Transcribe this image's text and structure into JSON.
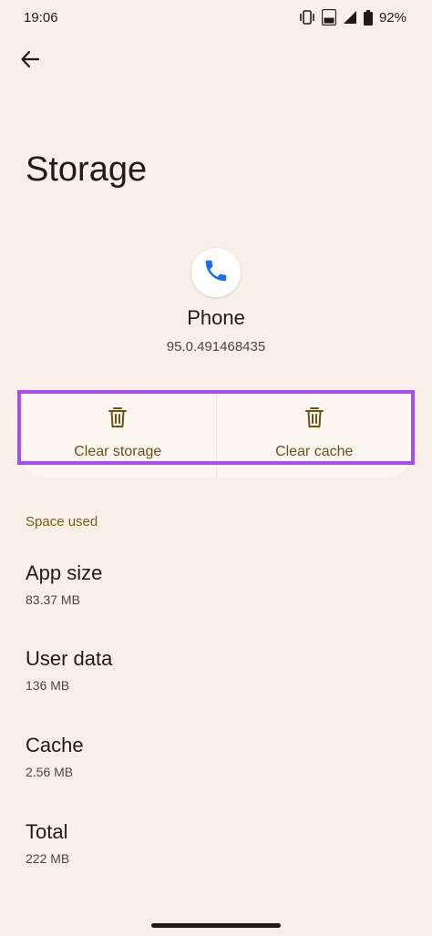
{
  "status_bar": {
    "time": "19:06",
    "battery": "92%",
    "icons": [
      "vibrate-icon",
      "volte-icon",
      "signal-icon",
      "battery-icon"
    ],
    "volte_text": "Vo LTE"
  },
  "header": {
    "back_icon": "arrow-back-icon",
    "title": "Storage"
  },
  "app": {
    "icon": "phone-icon",
    "name": "Phone",
    "version": "95.0.491468435"
  },
  "actions": {
    "clear_storage": {
      "label": "Clear storage",
      "icon": "trash-icon"
    },
    "clear_cache": {
      "label": "Clear cache",
      "icon": "trash-icon"
    }
  },
  "space_used": {
    "header": "Space used",
    "items": [
      {
        "label": "App size",
        "value": "83.37 MB"
      },
      {
        "label": "User data",
        "value": "136 MB"
      },
      {
        "label": "Cache",
        "value": "2.56 MB"
      },
      {
        "label": "Total",
        "value": "222 MB"
      }
    ]
  },
  "colors": {
    "background": "#f8f0e8",
    "accent": "#7a5d12",
    "button_text": "#6a5213",
    "highlight": "#a84ef0",
    "phone_icon": "#1a6ee8"
  }
}
